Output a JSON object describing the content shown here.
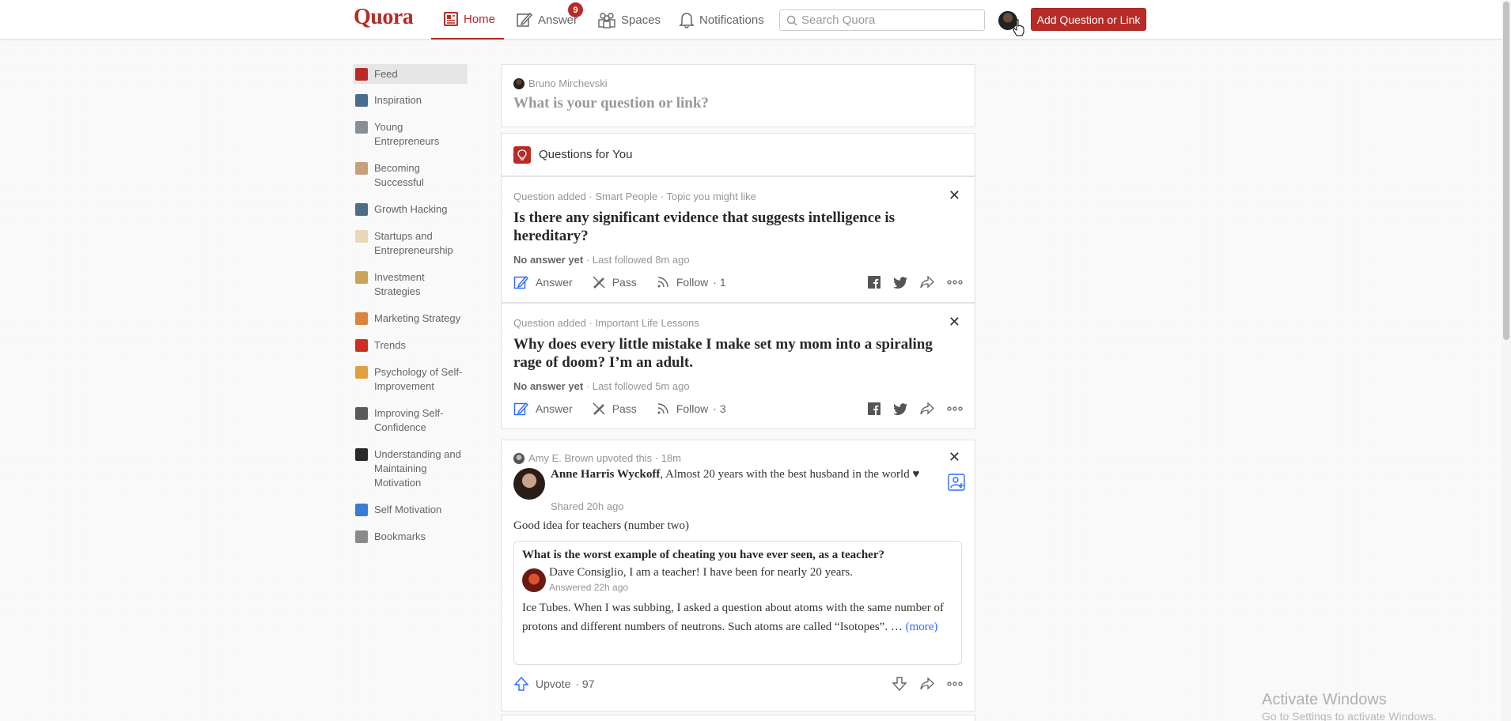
{
  "header": {
    "logo": "Quora",
    "nav": {
      "home": "Home",
      "answer": "Answer",
      "answer_badge": "9",
      "spaces": "Spaces",
      "notifications": "Notifications"
    },
    "search_placeholder": "Search Quora",
    "add_button": "Add Question or Link"
  },
  "sidebar": {
    "items": [
      {
        "label": "Feed",
        "color": "#b92b27"
      },
      {
        "label": "Inspiration",
        "color": "#4a6d8c"
      },
      {
        "label": "Young Entrepreneurs",
        "color": "#8a8f96"
      },
      {
        "label": "Becoming Successful",
        "color": "#c7a07a"
      },
      {
        "label": "Growth Hacking",
        "color": "#4d6e87"
      },
      {
        "label": "Startups and Entrepreneurship",
        "color": "#e8d9b8"
      },
      {
        "label": "Investment Strategies",
        "color": "#c8a55a"
      },
      {
        "label": "Marketing Strategy",
        "color": "#d9853b"
      },
      {
        "label": "Trends",
        "color": "#cc2f1f"
      },
      {
        "label": "Psychology of Self-Improvement",
        "color": "#e0a040"
      },
      {
        "label": "Improving Self-Confidence",
        "color": "#5a5a5a"
      },
      {
        "label": "Understanding and Maintaining Motivation",
        "color": "#2a2a2a"
      },
      {
        "label": "Self Motivation",
        "color": "#3a7bd5"
      },
      {
        "label": "Bookmarks",
        "color": "#8a8a8a"
      }
    ]
  },
  "ask": {
    "user": "Bruno Mirchevski",
    "prompt": "What is your question or link?"
  },
  "questions_for_you": {
    "title": "Questions for You"
  },
  "questions": [
    {
      "meta": "Question added · Smart People · Topic you might like",
      "title": "Is there any significant evidence that suggests intelligence is hereditary?",
      "no_answer": "No answer yet",
      "followed": " · Last followed 8m ago",
      "answer_label": "Answer",
      "pass_label": "Pass",
      "follow_label": "Follow",
      "follow_count": "· 1"
    },
    {
      "meta": "Question added · Important Life Lessons",
      "title": "Why does every little mistake I make set my mom into a spiraling rage of doom? I’m an adult.",
      "no_answer": "No answer yet",
      "followed": " · Last followed 5m ago",
      "answer_label": "Answer",
      "pass_label": "Pass",
      "follow_label": "Follow",
      "follow_count": "· 3"
    }
  ],
  "post": {
    "upvoted_by": "Amy E. Brown upvoted this · 18m",
    "author_name": "Anne Harris Wyckoff",
    "author_cred": ", Almost 20 years with the best husband in the world ♥",
    "shared": "Shared 20h ago",
    "text": "Good idea for teachers (number two)",
    "inner": {
      "question": "What is the worst example of cheating you have ever seen, as a teacher?",
      "author": "Dave Consiglio, I am a teacher! I have been for nearly 20 years.",
      "answered": "Answered 22h ago",
      "body": "Ice Tubes. When I was subbing, I asked a question about atoms with the same number of protons and different numbers of neutrons. Such atoms are called “Isotopes”. …",
      "more": "(more)"
    },
    "upvote_label": "Upvote",
    "upvote_count": "· 97"
  },
  "watermark": {
    "title": "Activate Windows",
    "subtitle": "Go to Settings to activate Windows."
  },
  "colors": {
    "brand": "#b92b27",
    "link": "#2e69ff"
  }
}
